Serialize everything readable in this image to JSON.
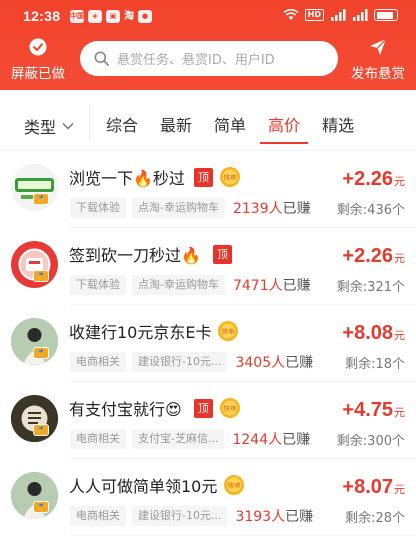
{
  "statusbar": {
    "time": "12:38",
    "app_labels": [
      "中国",
      "淘"
    ]
  },
  "header": {
    "left_button": "屏蔽已做",
    "search_placeholder": "悬赏任务、悬赏ID、用户ID",
    "right_button": "发布悬赏"
  },
  "filter": {
    "type_label": "类型",
    "tabs": [
      "综合",
      "最新",
      "简单",
      "高价",
      "精选"
    ],
    "active_tab": "高价"
  },
  "colors": {
    "brand_red": "#f2432c",
    "price_red": "#e63a2d",
    "top_badge": "#e7342b"
  },
  "tasks": [
    {
      "title": "浏览一下🔥秒过",
      "top_badge": "顶",
      "speed_badge": "快审",
      "tags": [
        "下载体验",
        "点淘-幸运购物车"
      ],
      "earned_count": "2139人",
      "earned_suffix": "已赚",
      "price": "+2.26",
      "unit": "元",
      "remaining": "剩余:436个"
    },
    {
      "title": "签到砍一刀秒过🔥",
      "top_badge": "顶",
      "speed_badge": "",
      "tags": [
        "下载体验",
        "点淘-幸运购物车"
      ],
      "earned_count": "7471人",
      "earned_suffix": "已赚",
      "price": "+2.26",
      "unit": "元",
      "remaining": "剩余:321个"
    },
    {
      "title": "收建行10元京东E卡",
      "top_badge": "",
      "speed_badge": "快审",
      "tags": [
        "电商相关",
        "建设银行-10元..."
      ],
      "earned_count": "3405人",
      "earned_suffix": "已赚",
      "price": "+8.08",
      "unit": "元",
      "remaining": "剩余:18个"
    },
    {
      "title": "有支付宝就行😍",
      "top_badge": "顶",
      "speed_badge": "快审",
      "tags": [
        "电商相关",
        "支付宝-芝麻信..."
      ],
      "earned_count": "1244人",
      "earned_suffix": "已赚",
      "price": "+4.75",
      "unit": "元",
      "remaining": "剩余:300个"
    },
    {
      "title": "人人可做简单领10元",
      "top_badge": "",
      "speed_badge": "快审",
      "tags": [
        "电商相关",
        "建设银行-10元..."
      ],
      "earned_count": "3193人",
      "earned_suffix": "已赚",
      "price": "+8.07",
      "unit": "元",
      "remaining": "剩余:28个"
    }
  ]
}
